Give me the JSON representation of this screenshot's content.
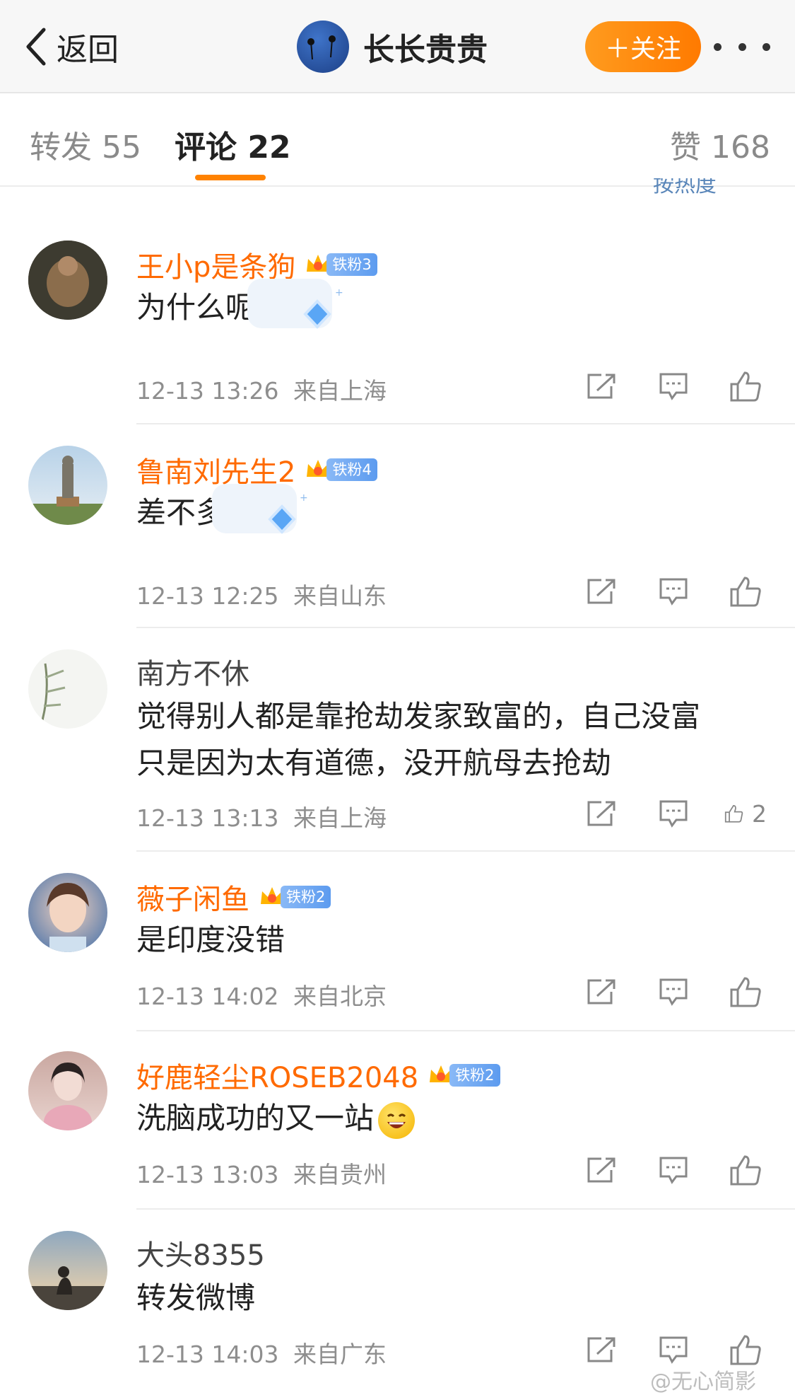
{
  "header": {
    "back_label": "返回",
    "title": "长长贵贵",
    "follow_label": "＋关注"
  },
  "tabs": {
    "repost": "转发 55",
    "comments": "评论 22",
    "likes": "赞 168",
    "sort_label": "按热度"
  },
  "comments": [
    {
      "name": "王小p是条狗",
      "badge": "铁粉3",
      "text": "为什么呢",
      "time": "12-13 13:26",
      "location": "来自上海",
      "likes": ""
    },
    {
      "name": "鲁南刘先生2",
      "badge": "铁粉4",
      "text": "差不多",
      "time": "12-13 12:25",
      "location": "来自山东",
      "likes": ""
    },
    {
      "name": "南方不休",
      "badge": "",
      "text_line1": "觉得别人都是靠抢劫发家致富的，自己没富",
      "text_line2": "只是因为太有道德，没开航母去抢劫",
      "time": "12-13 13:13",
      "location": "来自上海",
      "likes": "2"
    },
    {
      "name": "薇子闲鱼",
      "badge": "铁粉2",
      "text": "是印度没错",
      "time": "12-13 14:02",
      "location": "来自北京",
      "likes": ""
    },
    {
      "name": "好鹿轻尘ROSEB2048",
      "badge": "铁粉2",
      "text": "洗脑成功的又一站",
      "time": "12-13 13:03",
      "location": "来自贵州",
      "likes": ""
    },
    {
      "name": "大头8355",
      "badge": "",
      "text": "转发微博",
      "time": "12-13 14:03",
      "location": "来自广东",
      "likes": ""
    }
  ],
  "watermark": "@无心简影",
  "colors": {
    "accent": "#ff8200",
    "vip_name": "#ff6a00",
    "badge_blue": "#5c9bef"
  }
}
